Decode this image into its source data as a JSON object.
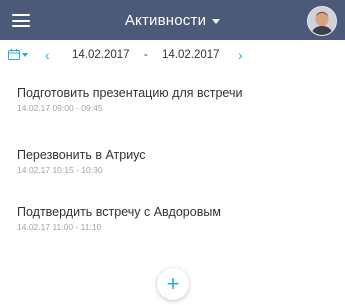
{
  "header": {
    "title": "Активности",
    "colors": {
      "bar": "#4a5a78",
      "accent": "#2aa8e0"
    }
  },
  "datebar": {
    "calendar_icon": "calendar-icon",
    "prev_icon": "chevron-left-icon",
    "next_icon": "chevron-right-icon",
    "date_from": "14.02.2017",
    "separator": "-",
    "date_to": "14.02.2017"
  },
  "activities": [
    {
      "title": "Подготовить презентацию для встречи",
      "time": "14.02.17 09:00 - 09:45"
    },
    {
      "title": "Перезвонить в Атриус",
      "time": "14.02.17 10:15 - 10:30"
    },
    {
      "title": "Подтвердить встречу  с  Авдоровым",
      "time": "14.02.17 11:00 - 11:10"
    }
  ],
  "add_button": {
    "icon": "plus-icon",
    "label": "+"
  }
}
